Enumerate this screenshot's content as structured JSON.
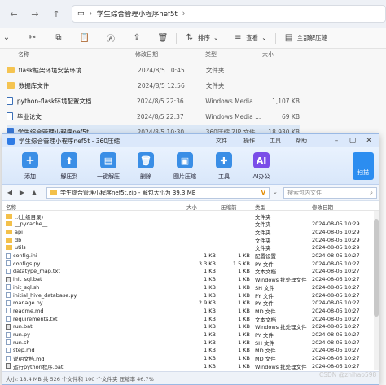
{
  "explorer": {
    "address": "学生综合管理小程序nef5t",
    "toolbar": {
      "sort_label": "排序",
      "view_label": "查看",
      "extract_all_label": "全部解压缩"
    },
    "columns": {
      "name": "名称",
      "date": "修改日期",
      "type": "类型",
      "size": "大小"
    },
    "files": [
      {
        "name": "flask框架环境安装环境",
        "date": "2024/8/5 10:45",
        "type": "文件夹",
        "size": "",
        "icon": "folder"
      },
      {
        "name": "数据库文件",
        "date": "2024/8/5 12:56",
        "type": "文件夹",
        "size": "",
        "icon": "folder"
      },
      {
        "name": "python-flask环境配置文档",
        "date": "2024/8/5 22:36",
        "type": "Windows Media ...",
        "size": "1,107 KB",
        "icon": "doc"
      },
      {
        "name": "毕业论文",
        "date": "2024/8/5 22:37",
        "type": "Windows Media ...",
        "size": "69 KB",
        "icon": "doc"
      },
      {
        "name": "学生综合管理小程序nef5t",
        "date": "2024/8/5 10:30",
        "type": "360压缩 ZIP 文件",
        "size": "18,930 KB",
        "icon": "zip"
      }
    ]
  },
  "zip": {
    "title": "学生综合管理小程序nef5t - 360压缩",
    "menus": [
      "文件",
      "操作",
      "工具",
      "帮助"
    ],
    "tools": [
      {
        "label": "添加",
        "icon": "add-icon",
        "color": "#3a8ee6"
      },
      {
        "label": "解压到",
        "icon": "extract-to-icon",
        "color": "#3a8ee6"
      },
      {
        "label": "一键解压",
        "icon": "one-click-extract-icon",
        "color": "#3a8ee6"
      },
      {
        "label": "删除",
        "icon": "delete-icon",
        "color": "#3a8ee6"
      },
      {
        "label": "图片压缩",
        "icon": "image-compress-icon",
        "color": "#3a8ee6"
      },
      {
        "label": "工具",
        "icon": "tools-icon",
        "color": "#3a8ee6"
      },
      {
        "label": "AI办公",
        "icon": "ai-office-icon",
        "color": "#7a4de8"
      }
    ],
    "scan_label": "扫描",
    "path": "学生综合管理小程序nef5t.zip - 解包大小为 39.3 MB",
    "search_placeholder": "搜索包内文件",
    "columns": {
      "name": "名称",
      "size": "大小",
      "compressed": "压缩前",
      "type": "类型",
      "date": "修改日期"
    },
    "entries": [
      {
        "name": "..(上级目录)",
        "size": "",
        "comp": "",
        "type": "文件夹",
        "date": "",
        "kind": "folder"
      },
      {
        "name": "__pycache__",
        "size": "",
        "comp": "",
        "type": "文件夹",
        "date": "2024-08-05 10:29",
        "kind": "folder"
      },
      {
        "name": "api",
        "size": "",
        "comp": "",
        "type": "文件夹",
        "date": "2024-08-05 10:29",
        "kind": "folder"
      },
      {
        "name": "db",
        "size": "",
        "comp": "",
        "type": "文件夹",
        "date": "2024-08-05 10:29",
        "kind": "folder"
      },
      {
        "name": "utils",
        "size": "",
        "comp": "",
        "type": "文件夹",
        "date": "2024-08-05 10:29",
        "kind": "folder"
      },
      {
        "name": "config.ini",
        "size": "1 KB",
        "comp": "1 KB",
        "type": "配置设置",
        "date": "2024-08-05 10:27",
        "kind": "file"
      },
      {
        "name": "configs.py",
        "size": "3.3 KB",
        "comp": "1.5 KB",
        "type": "PY 文件",
        "date": "2024-08-05 10:27",
        "kind": "file"
      },
      {
        "name": "datatype_map.txt",
        "size": "1 KB",
        "comp": "1 KB",
        "type": "文本文档",
        "date": "2024-08-05 10:27",
        "kind": "file"
      },
      {
        "name": "init_sql.bat",
        "size": "1 KB",
        "comp": "1 KB",
        "type": "Windows 批处理文件",
        "date": "2024-08-05 10:27",
        "kind": "bat"
      },
      {
        "name": "init_sql.sh",
        "size": "1 KB",
        "comp": "1 KB",
        "type": "SH 文件",
        "date": "2024-08-05 10:27",
        "kind": "file"
      },
      {
        "name": "initial_hive_database.py",
        "size": "1 KB",
        "comp": "1 KB",
        "type": "PY 文件",
        "date": "2024-08-05 10:27",
        "kind": "file"
      },
      {
        "name": "manage.py",
        "size": "2.9 KB",
        "comp": "1 KB",
        "type": "PY 文件",
        "date": "2024-08-05 10:27",
        "kind": "file"
      },
      {
        "name": "readme.md",
        "size": "1 KB",
        "comp": "1 KB",
        "type": "MD 文件",
        "date": "2024-08-05 10:27",
        "kind": "file"
      },
      {
        "name": "requirements.txt",
        "size": "1 KB",
        "comp": "1 KB",
        "type": "文本文档",
        "date": "2024-08-05 10:27",
        "kind": "file"
      },
      {
        "name": "run.bat",
        "size": "1 KB",
        "comp": "1 KB",
        "type": "Windows 批处理文件",
        "date": "2024-08-05 10:27",
        "kind": "bat"
      },
      {
        "name": "run.py",
        "size": "1 KB",
        "comp": "1 KB",
        "type": "PY 文件",
        "date": "2024-08-05 10:27",
        "kind": "file"
      },
      {
        "name": "run.sh",
        "size": "1 KB",
        "comp": "1 KB",
        "type": "SH 文件",
        "date": "2024-08-05 10:27",
        "kind": "file"
      },
      {
        "name": "step.md",
        "size": "1 KB",
        "comp": "1 KB",
        "type": "MD 文件",
        "date": "2024-08-05 10:27",
        "kind": "file"
      },
      {
        "name": "说明文档.md",
        "size": "1 KB",
        "comp": "1 KB",
        "type": "MD 文件",
        "date": "2024-08-05 10:27",
        "kind": "file"
      },
      {
        "name": "运行python程序.bat",
        "size": "1 KB",
        "comp": "1 KB",
        "type": "Windows 批处理文件",
        "date": "2024-08-05 10:27",
        "kind": "bat"
      }
    ],
    "status": "大小: 18.4 MB 共 526 个文件和 100 个文件夹 压缩率 46.7%"
  },
  "watermark": "CSDN @zhihao598"
}
